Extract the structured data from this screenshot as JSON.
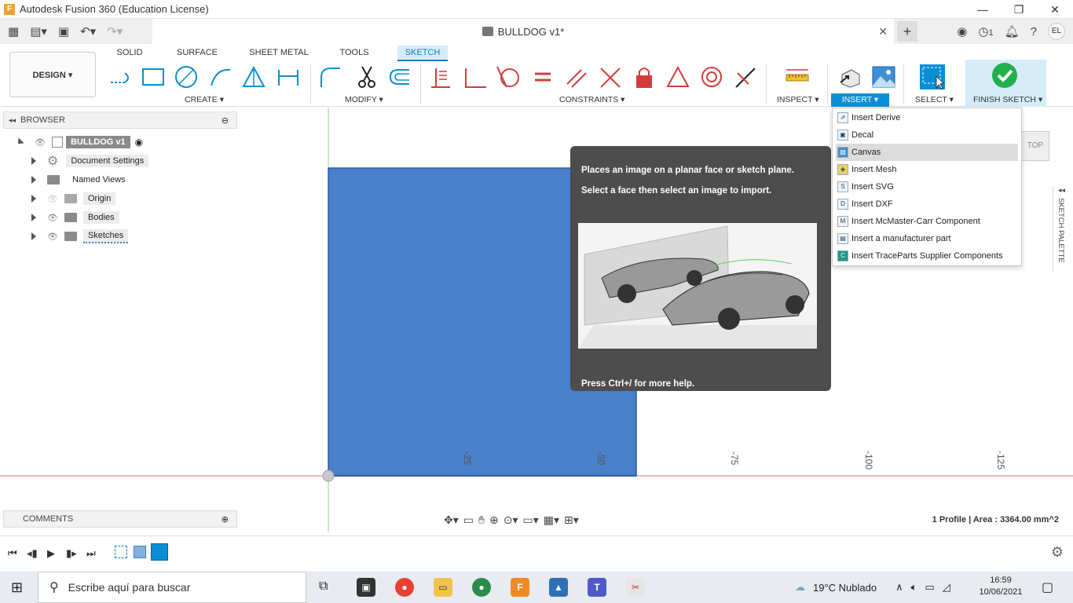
{
  "window": {
    "app_icon": "F",
    "title": "Autodesk Fusion 360 (Education License)",
    "minimize": "—",
    "maximize": "❐",
    "close": "✕"
  },
  "tabs": {
    "document_name": "BULLDOG v1*",
    "jobs_count": "1",
    "user_initials": "EL"
  },
  "ribbon": {
    "workspace": "DESIGN ▾",
    "workspace_tabs": [
      "SOLID",
      "SURFACE",
      "SHEET METAL",
      "TOOLS",
      "SKETCH"
    ],
    "active_tab": "SKETCH",
    "groups": {
      "create": "CREATE ▾",
      "modify": "MODIFY ▾",
      "constraints": "CONSTRAINTS ▾",
      "inspect": "INSPECT ▾",
      "insert": "INSERT ▾",
      "select": "SELECT ▾",
      "finish": "FINISH SKETCH ▾"
    },
    "accent_color": "#0a8fd5",
    "finish_color": "#22b04c"
  },
  "browser": {
    "header": "BROWSER",
    "root": "BULLDOG v1",
    "items": [
      "Document Settings",
      "Named Views",
      "Origin",
      "Bodies",
      "Sketches"
    ]
  },
  "comments": {
    "header": "COMMENTS"
  },
  "viewcube": {
    "face": "TOP"
  },
  "sketch_palette": {
    "label": "SKETCH PALETTE"
  },
  "axis_labels": [
    "-25",
    "-50",
    "-75",
    "-100",
    "-125"
  ],
  "tooltip": {
    "line1": "Places an image on a planar face or sketch plane.",
    "line2": "Select a face then select an image to import.",
    "help": "Press Ctrl+/ for more help."
  },
  "insert_menu": {
    "items": [
      {
        "label": "Insert Derive",
        "icon": "derive-icon"
      },
      {
        "label": "Decal",
        "icon": "decal-icon"
      },
      {
        "label": "Canvas",
        "icon": "canvas-icon"
      },
      {
        "label": "Insert Mesh",
        "icon": "mesh-icon"
      },
      {
        "label": "Insert SVG",
        "icon": "svg-icon"
      },
      {
        "label": "Insert DXF",
        "icon": "dxf-icon"
      },
      {
        "label": "Insert McMaster-Carr Component",
        "icon": "mcmaster-icon"
      },
      {
        "label": "Insert a manufacturer part",
        "icon": "manufacturer-part-icon"
      },
      {
        "label": "Insert TraceParts Supplier Components",
        "icon": "traceparts-icon"
      }
    ],
    "highlighted": "Canvas"
  },
  "status": {
    "profile_info": "1 Profile | Area : 3364.00 mm^2"
  },
  "taskbar": {
    "search_placeholder": "Escribe aquí para buscar",
    "weather": "19°C  Nublado",
    "time": "16:59",
    "date": "10/06/2021"
  },
  "colors": {
    "sketch_profile": "#4a7fca",
    "tooltip_bg": "#4d4d4d",
    "axis_red": "#e35b5b",
    "axis_green": "#7fcf7f"
  }
}
